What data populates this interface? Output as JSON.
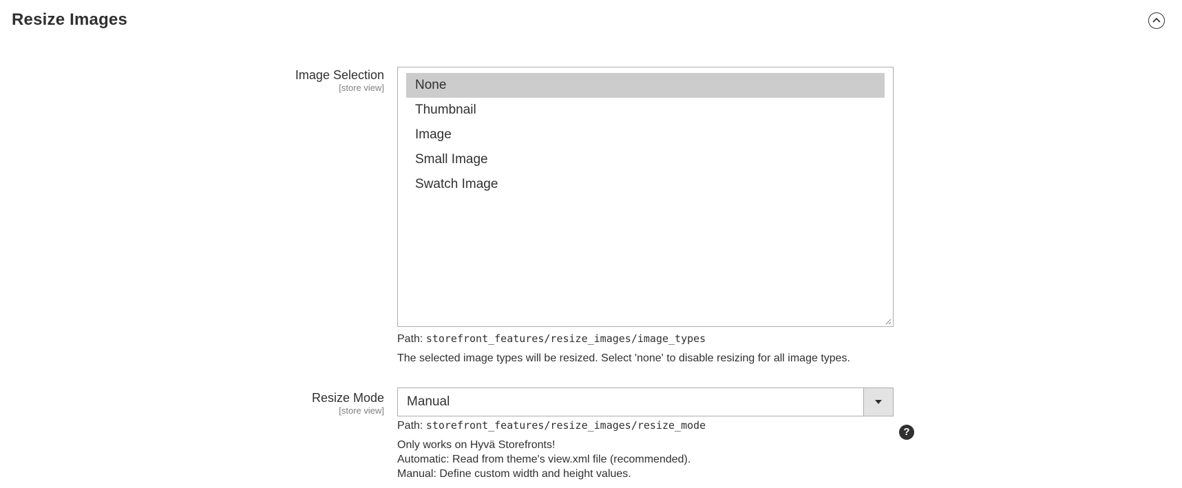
{
  "section": {
    "title": "Resize Images",
    "collapse_icon": "chevron-up-circle-icon"
  },
  "image_selection": {
    "label": "Image Selection",
    "scope": "[store view]",
    "options": [
      {
        "label": "None",
        "selected": true
      },
      {
        "label": "Thumbnail",
        "selected": false
      },
      {
        "label": "Image",
        "selected": false
      },
      {
        "label": "Small Image",
        "selected": false
      },
      {
        "label": "Swatch Image",
        "selected": false
      }
    ],
    "path_label": "Path:",
    "path_value": "storefront_features/resize_images/image_types",
    "comment": "The selected image types will be resized. Select 'none' to disable resizing for all image types."
  },
  "resize_mode": {
    "label": "Resize Mode",
    "scope": "[store view]",
    "value": "Manual",
    "path_label": "Path:",
    "path_value": "storefront_features/resize_images/resize_mode",
    "comment_lines": [
      "Only works on Hyvä Storefronts!",
      "Automatic: Read from theme's view.xml file (recommended).",
      "Manual: Define custom width and height values."
    ],
    "help_icon": "question-mark-icon",
    "help_glyph": "?"
  },
  "colors": {
    "text": "#303030",
    "selected_option_bg": "#cccccc",
    "border": "#adadad",
    "arrow_bg": "#e3e3e3"
  }
}
